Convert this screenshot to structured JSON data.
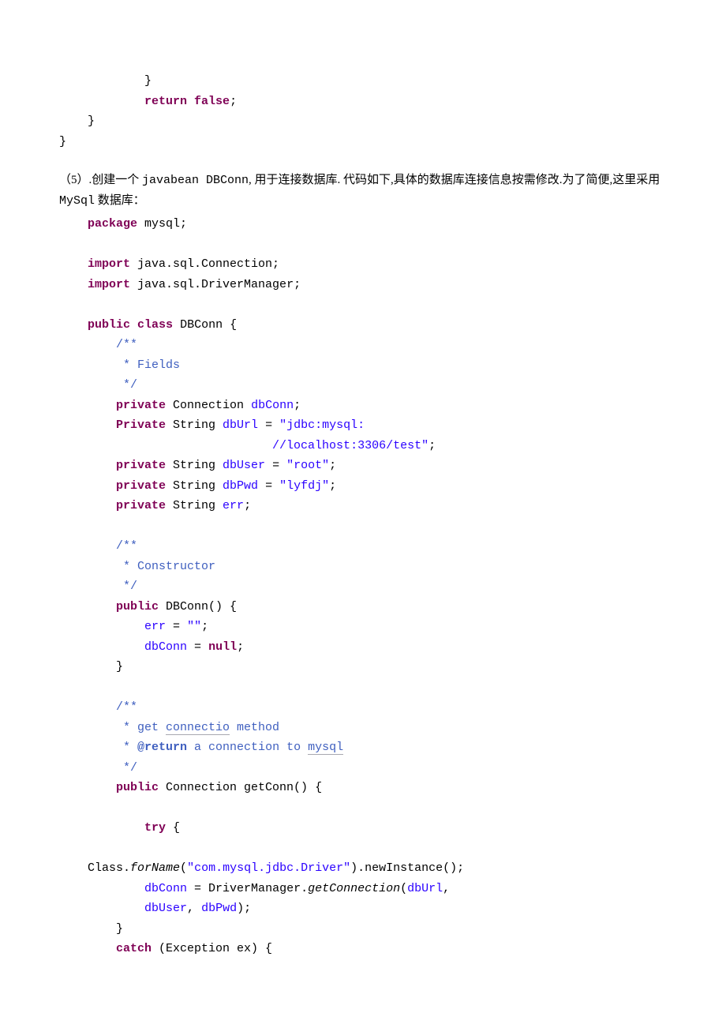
{
  "block1": {
    "l1": "            }",
    "l2a": "            ",
    "l2b": "return false",
    "l2c": ";",
    "l3": "    }",
    "l4": "}"
  },
  "para": {
    "prefix": "（5）.创建一个 ",
    "jb": "javabean DBConn",
    "mid1": ", 用于连接数据库. 代码如下,具体的数据库连接信息按需修改.为了简便,这里采用 ",
    "mysql": "MySql",
    "mid2": " 数据库："
  },
  "code": {
    "l01_pad": "    ",
    "l01_kw": "package",
    "l01_rest": " mysql;",
    "l03_pad": "    ",
    "l03_kw": "import",
    "l03_rest": " java.sql.Connection;",
    "l04_pad": "    ",
    "l04_kw": "import",
    "l04_rest": " java.sql.DriverManager;",
    "l06_pad": "    ",
    "l06_kw1": "public",
    "l06_kw2": "class",
    "l06_rest": " DBConn {",
    "l07": "        /**",
    "l08": "         * Fields",
    "l09": "         */",
    "l10_pad": "        ",
    "l10_kw": "private",
    "l10_rest1": " Connection ",
    "l10_fld": "dbConn",
    "l10_rest2": ";",
    "l11_pad": "        ",
    "l11_kw": "Private",
    "l11_rest1": " String ",
    "l11_fld": "dbUrl",
    "l11_rest2": " = ",
    "l11_str": "\"jdbc:mysql:",
    "l11b_pad": "                              ",
    "l11b_str": "//localhost:3306/test\"",
    "l11b_rest": ";",
    "l12_pad": "        ",
    "l12_kw": "private",
    "l12_rest1": " String ",
    "l12_fld": "dbUser",
    "l12_rest2": " = ",
    "l12_str": "\"root\"",
    "l12_rest3": ";",
    "l13_pad": "        ",
    "l13_kw": "private",
    "l13_rest1": " String ",
    "l13_fld": "dbPwd",
    "l13_rest2": " = ",
    "l13_str": "\"lyfdj\"",
    "l13_rest3": ";",
    "l14_pad": "        ",
    "l14_kw": "private",
    "l14_rest1": " String ",
    "l14_fld": "err",
    "l14_rest2": ";",
    "l16": "        /**",
    "l17": "         * Constructor",
    "l18": "         */",
    "l19_pad": "        ",
    "l19_kw": "public",
    "l19_rest": " DBConn() {",
    "l20_pad": "            ",
    "l20_fld": "err",
    "l20_rest1": " = ",
    "l20_str": "\"\"",
    "l20_rest2": ";",
    "l21_pad": "            ",
    "l21_fld": "dbConn",
    "l21_rest1": " = ",
    "l21_kw": "null",
    "l21_rest2": ";",
    "l22": "        }",
    "l24": "        /**",
    "l25a": "         * get ",
    "l25b": "connectio",
    "l25c": " method",
    "l26a": "         * ",
    "l26tag": "@return",
    "l26b": " a connection to ",
    "l26c": "mysql",
    "l27": "         */",
    "l28_pad": "        ",
    "l28_kw": "public",
    "l28_rest": " Connection getConn() {",
    "l30_pad": "            ",
    "l30_kw": "try",
    "l30_rest": " {",
    "l32_pad": "    ",
    "l32a": "Class.",
    "l32b": "forName",
    "l32c": "(",
    "l32str": "\"com.mysql.jdbc.Driver\"",
    "l32d": ").newInstance();",
    "l33_pad": "            ",
    "l33_fld": "dbConn",
    "l33_rest1": " = DriverManager.",
    "l33b": "getConnection",
    "l33_rest2": "(",
    "l33_fld2": "dbUrl",
    "l33_rest3": ",",
    "l34_pad": "            ",
    "l34_fld1": "dbUser",
    "l34_rest1": ", ",
    "l34_fld2": "dbPwd",
    "l34_rest2": ");",
    "l35": "        }",
    "l36_pad": "        ",
    "l36_kw": "catch",
    "l36_rest": " (Exception ex) {"
  }
}
